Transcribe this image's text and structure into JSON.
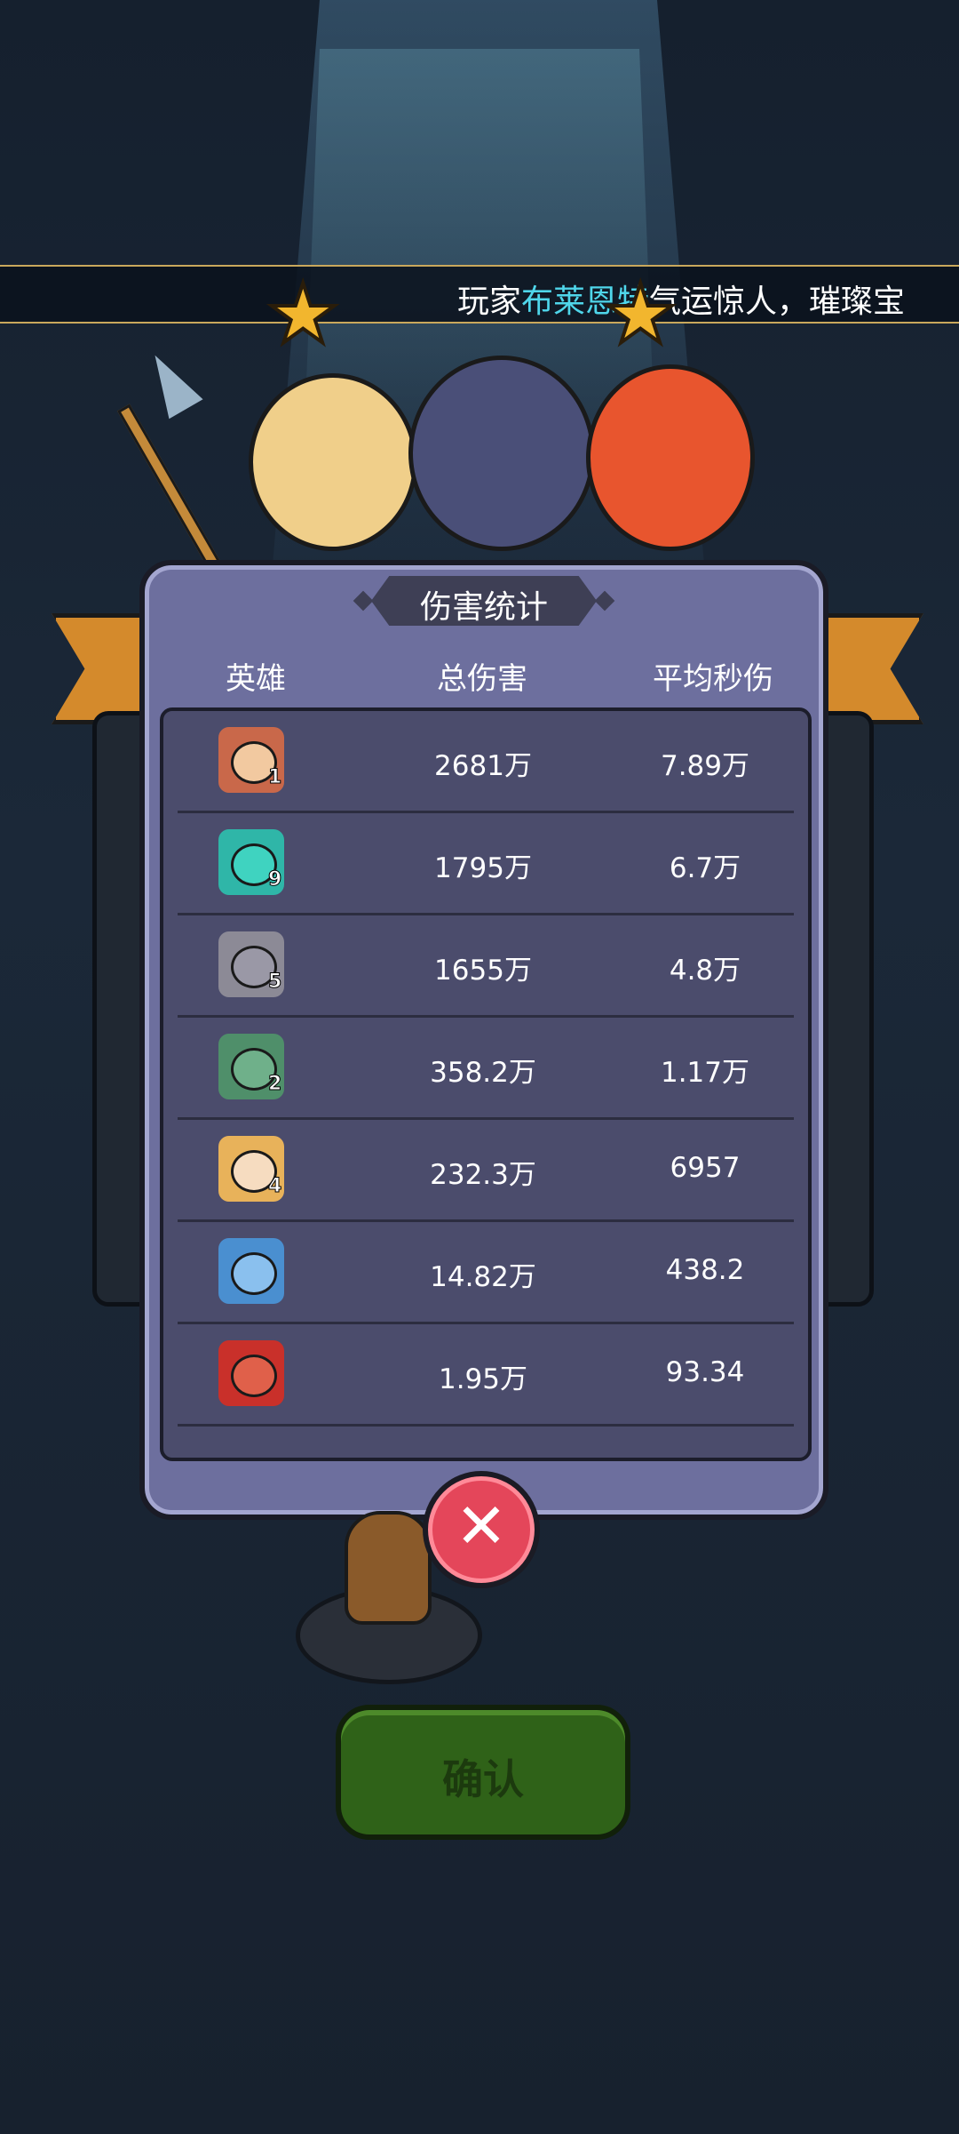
{
  "ticker": {
    "prefix": "玩家",
    "player": "布莱恩特",
    "suffix": "气运惊人，璀璨宝"
  },
  "popup": {
    "title": "伤害统计",
    "headers": {
      "hero": "英雄",
      "total": "总伤害",
      "dps": "平均秒伤"
    },
    "rows": [
      {
        "level": "1",
        "total": "2681万",
        "dps": "7.89万",
        "color": "#c9684a"
      },
      {
        "level": "9",
        "total": "1795万",
        "dps": "6.7万",
        "color": "#2fb6a8"
      },
      {
        "level": "5",
        "total": "1655万",
        "dps": "4.8万",
        "color": "#8c8a96"
      },
      {
        "level": "2",
        "total": "358.2万",
        "dps": "1.17万",
        "color": "#4f8f6a"
      },
      {
        "level": "4",
        "total": "232.3万",
        "dps": "6957",
        "color": "#e8b25a"
      },
      {
        "level": "",
        "total": "14.82万",
        "dps": "438.2",
        "color": "#4a8fd0"
      },
      {
        "level": "",
        "total": "1.95万",
        "dps": "93.34",
        "color": "#c9302a"
      }
    ]
  },
  "close_icon": "close-icon",
  "confirm": {
    "label": "确认"
  },
  "colors": {
    "accent": "#4fd6ea",
    "popup": "#6d6f9e",
    "close": "#e4465a",
    "confirm": "#2f6218"
  }
}
